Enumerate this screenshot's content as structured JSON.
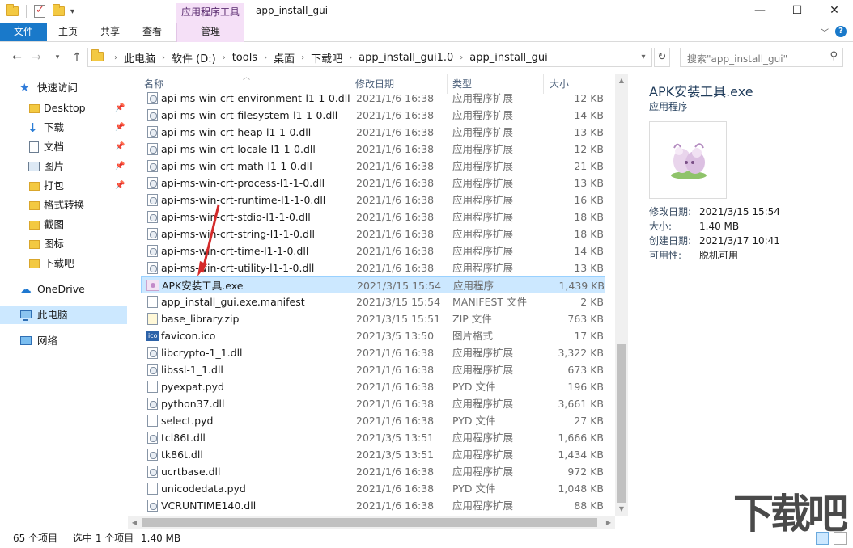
{
  "window": {
    "title": "app_install_gui",
    "context_tab_header": "应用程序工具",
    "buttons": {
      "minimize": "—",
      "maximize": "☐",
      "close": "✕"
    }
  },
  "ribbon": {
    "tabs": [
      "文件",
      "主页",
      "共享",
      "查看",
      "管理"
    ],
    "help": "?"
  },
  "address": {
    "crumbs": [
      "此电脑",
      "软件 (D:)",
      "tools",
      "桌面",
      "下载吧",
      "app_install_gui1.0",
      "app_install_gui"
    ],
    "search_placeholder": "搜索\"app_install_gui\""
  },
  "sidebar": {
    "items": [
      {
        "label": "快速访问",
        "icon": "star-icon"
      },
      {
        "label": "Desktop",
        "icon": "folder-icon",
        "pinned": true
      },
      {
        "label": "下载",
        "icon": "download-icon",
        "pinned": true
      },
      {
        "label": "文档",
        "icon": "document-icon",
        "pinned": true
      },
      {
        "label": "图片",
        "icon": "pictures-icon",
        "pinned": true
      },
      {
        "label": "打包",
        "icon": "folder-icon",
        "pinned": true
      },
      {
        "label": "格式转换",
        "icon": "folder-icon"
      },
      {
        "label": "截图",
        "icon": "folder-icon"
      },
      {
        "label": "图标",
        "icon": "folder-icon"
      },
      {
        "label": "下载吧",
        "icon": "folder-icon"
      },
      {
        "label": "OneDrive",
        "icon": "cloud-icon"
      },
      {
        "label": "此电脑",
        "icon": "computer-icon",
        "selected": true
      },
      {
        "label": "网络",
        "icon": "network-icon"
      }
    ]
  },
  "filelist": {
    "columns": {
      "name": "名称",
      "date": "修改日期",
      "type": "类型",
      "size": "大小"
    },
    "rows": [
      {
        "name": "api-ms-win-crt-environment-l1-1-0.dll",
        "date": "2021/1/6 16:38",
        "type": "应用程序扩展",
        "size": "12 KB",
        "icon": "dll"
      },
      {
        "name": "api-ms-win-crt-filesystem-l1-1-0.dll",
        "date": "2021/1/6 16:38",
        "type": "应用程序扩展",
        "size": "14 KB",
        "icon": "dll"
      },
      {
        "name": "api-ms-win-crt-heap-l1-1-0.dll",
        "date": "2021/1/6 16:38",
        "type": "应用程序扩展",
        "size": "13 KB",
        "icon": "dll"
      },
      {
        "name": "api-ms-win-crt-locale-l1-1-0.dll",
        "date": "2021/1/6 16:38",
        "type": "应用程序扩展",
        "size": "12 KB",
        "icon": "dll"
      },
      {
        "name": "api-ms-win-crt-math-l1-1-0.dll",
        "date": "2021/1/6 16:38",
        "type": "应用程序扩展",
        "size": "21 KB",
        "icon": "dll"
      },
      {
        "name": "api-ms-win-crt-process-l1-1-0.dll",
        "date": "2021/1/6 16:38",
        "type": "应用程序扩展",
        "size": "13 KB",
        "icon": "dll"
      },
      {
        "name": "api-ms-win-crt-runtime-l1-1-0.dll",
        "date": "2021/1/6 16:38",
        "type": "应用程序扩展",
        "size": "16 KB",
        "icon": "dll"
      },
      {
        "name": "api-ms-win-crt-stdio-l1-1-0.dll",
        "date": "2021/1/6 16:38",
        "type": "应用程序扩展",
        "size": "18 KB",
        "icon": "dll"
      },
      {
        "name": "api-ms-win-crt-string-l1-1-0.dll",
        "date": "2021/1/6 16:38",
        "type": "应用程序扩展",
        "size": "18 KB",
        "icon": "dll"
      },
      {
        "name": "api-ms-win-crt-time-l1-1-0.dll",
        "date": "2021/1/6 16:38",
        "type": "应用程序扩展",
        "size": "14 KB",
        "icon": "dll"
      },
      {
        "name": "api-ms-win-crt-utility-l1-1-0.dll",
        "date": "2021/1/6 16:38",
        "type": "应用程序扩展",
        "size": "13 KB",
        "icon": "dll"
      },
      {
        "name": "APK安装工具.exe",
        "date": "2021/3/15 15:54",
        "type": "应用程序",
        "size": "1,439 KB",
        "icon": "exe",
        "selected": true
      },
      {
        "name": "app_install_gui.exe.manifest",
        "date": "2021/3/15 15:54",
        "type": "MANIFEST 文件",
        "size": "2 KB",
        "icon": "file"
      },
      {
        "name": "base_library.zip",
        "date": "2021/3/15 15:51",
        "type": "ZIP 文件",
        "size": "763 KB",
        "icon": "zip"
      },
      {
        "name": "favicon.ico",
        "date": "2021/3/5 13:50",
        "type": "图片格式",
        "size": "17 KB",
        "icon": "ico"
      },
      {
        "name": "libcrypto-1_1.dll",
        "date": "2021/1/6 16:38",
        "type": "应用程序扩展",
        "size": "3,322 KB",
        "icon": "dll"
      },
      {
        "name": "libssl-1_1.dll",
        "date": "2021/1/6 16:38",
        "type": "应用程序扩展",
        "size": "673 KB",
        "icon": "dll"
      },
      {
        "name": "pyexpat.pyd",
        "date": "2021/1/6 16:38",
        "type": "PYD 文件",
        "size": "196 KB",
        "icon": "file"
      },
      {
        "name": "python37.dll",
        "date": "2021/1/6 16:38",
        "type": "应用程序扩展",
        "size": "3,661 KB",
        "icon": "dll"
      },
      {
        "name": "select.pyd",
        "date": "2021/1/6 16:38",
        "type": "PYD 文件",
        "size": "27 KB",
        "icon": "file"
      },
      {
        "name": "tcl86t.dll",
        "date": "2021/3/5 13:51",
        "type": "应用程序扩展",
        "size": "1,666 KB",
        "icon": "dll"
      },
      {
        "name": "tk86t.dll",
        "date": "2021/3/5 13:51",
        "type": "应用程序扩展",
        "size": "1,434 KB",
        "icon": "dll"
      },
      {
        "name": "ucrtbase.dll",
        "date": "2021/1/6 16:38",
        "type": "应用程序扩展",
        "size": "972 KB",
        "icon": "dll"
      },
      {
        "name": "unicodedata.pyd",
        "date": "2021/1/6 16:38",
        "type": "PYD 文件",
        "size": "1,048 KB",
        "icon": "file"
      },
      {
        "name": "VCRUNTIME140.dll",
        "date": "2021/1/6 16:38",
        "type": "应用程序扩展",
        "size": "88 KB",
        "icon": "dll"
      }
    ]
  },
  "details": {
    "title": "APK安装工具.exe",
    "subtitle": "应用程序",
    "props": [
      {
        "key": "修改日期:",
        "value": "2021/3/15 15:54"
      },
      {
        "key": "大小:",
        "value": "1.40 MB"
      },
      {
        "key": "创建日期:",
        "value": "2021/3/17 10:41"
      },
      {
        "key": "可用性:",
        "value": "脱机可用"
      }
    ]
  },
  "status": {
    "item_count": "65 个项目",
    "selection": "选中 1 个项目",
    "selection_size": "1.40 MB"
  },
  "watermark": {
    "text": "下载吧"
  },
  "colors": {
    "accent": "#1979ca",
    "selected_row": "#cce8ff",
    "context_tab": "#f5e0f7",
    "annotation_arrow": "#d42a2a"
  }
}
